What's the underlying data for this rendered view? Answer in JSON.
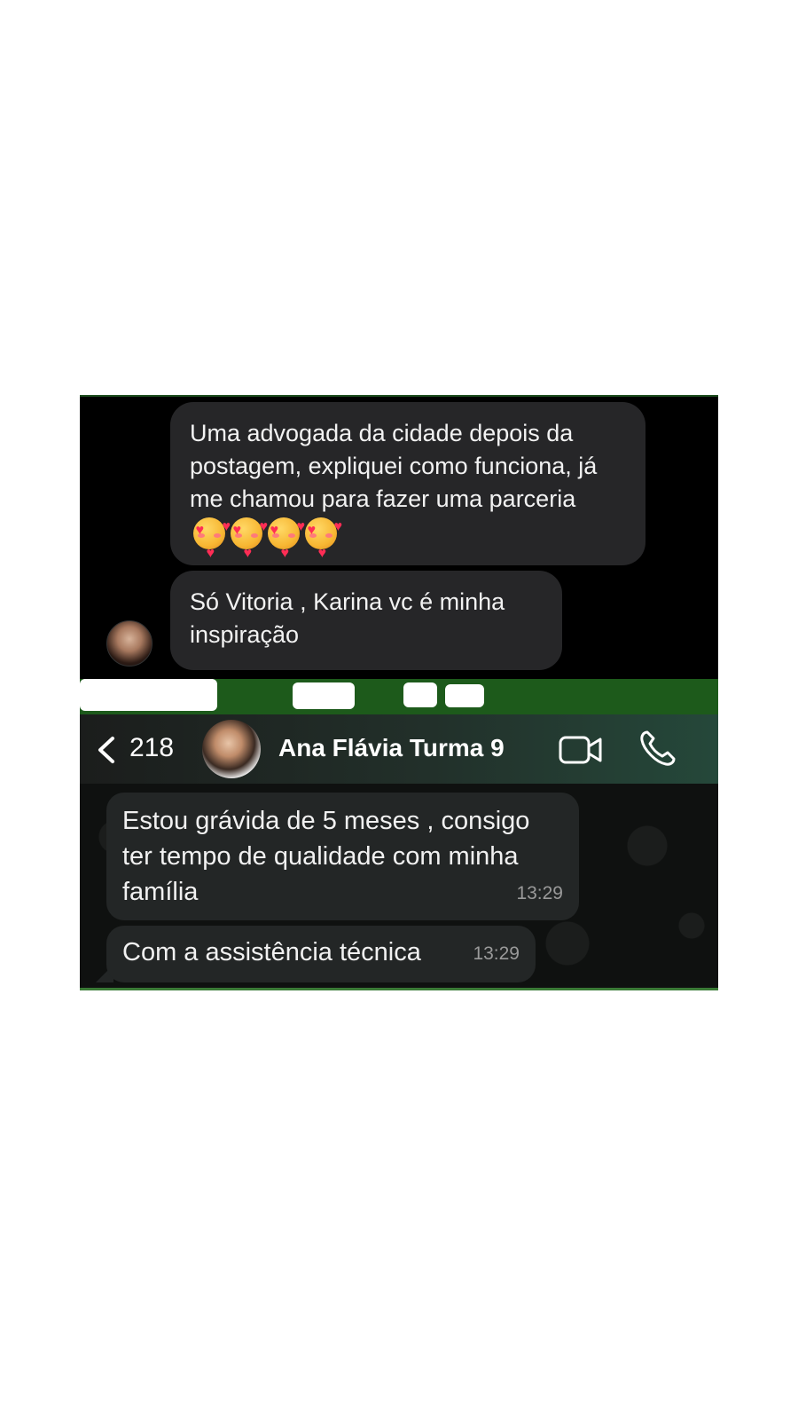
{
  "top_chat": {
    "messages": [
      {
        "text": "Uma advogada da cidade depois da postagem, expliquei como funciona, já me chamou para fazer uma parceria"
      },
      {
        "text": "Só Vitoria , Karina vc é minha inspiração"
      }
    ],
    "emoji_icons": [
      "smiling-face-with-hearts-icon",
      "smiling-face-with-hearts-icon",
      "smiling-face-with-hearts-icon",
      "smiling-face-with-hearts-icon"
    ]
  },
  "header": {
    "back_count": "218",
    "contact_name": "Ana Flávia Turma 9",
    "icons": [
      "back-chevron-icon",
      "video-call-icon",
      "phone-call-icon"
    ]
  },
  "chat": {
    "messages": [
      {
        "text": "Estou grávida de 5 meses , consigo ter tempo de qualidade com minha família",
        "time": "13:29"
      },
      {
        "text": "Com a assistência técnica",
        "time": "13:29"
      }
    ]
  },
  "colors": {
    "bubble_top": "#262628",
    "bubble_chat": "#232626",
    "strip_green": "#1d5a1b",
    "background": "#ffffff"
  }
}
